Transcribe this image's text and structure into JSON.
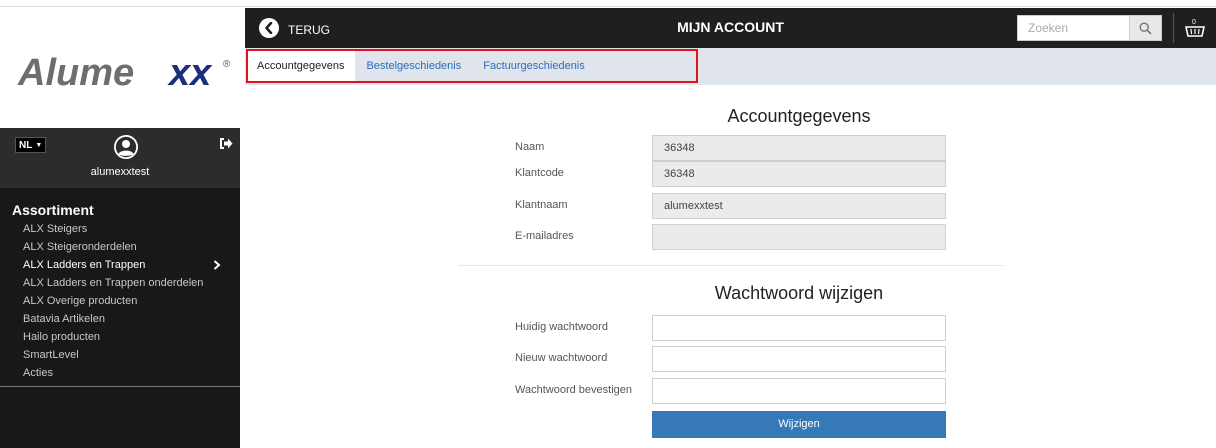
{
  "header": {
    "back_label": "TERUG",
    "title": "MIJN ACCOUNT",
    "search_placeholder": "Zoeken"
  },
  "logo": {
    "text": "Alumexx",
    "trademark": "®"
  },
  "tabs": [
    {
      "label": "Accountgegevens",
      "active": true
    },
    {
      "label": "Bestelgeschiedenis",
      "active": false
    },
    {
      "label": "Factuurgeschiedenis",
      "active": false
    }
  ],
  "sidebar": {
    "language": "NL",
    "username": "alumexxtest",
    "heading": "Assortiment",
    "items": [
      {
        "label": "ALX Steigers"
      },
      {
        "label": "ALX Steigeronderdelen"
      },
      {
        "label": "ALX Ladders en Trappen",
        "active": true
      },
      {
        "label": "ALX Ladders en Trappen onderdelen"
      },
      {
        "label": "ALX Overige producten"
      },
      {
        "label": "Batavia Artikelen"
      },
      {
        "label": "Hailo producten"
      },
      {
        "label": "SmartLevel"
      },
      {
        "label": "Acties"
      }
    ]
  },
  "account": {
    "title": "Accountgegevens",
    "fields": [
      {
        "label": "Naam",
        "value": "36348"
      },
      {
        "label": "Klantcode",
        "value": "36348"
      },
      {
        "label": "Klantnaam",
        "value": "alumexxtest"
      },
      {
        "label": "E-mailadres",
        "value": ""
      }
    ]
  },
  "password": {
    "title": "Wachtwoord wijzigen",
    "fields": [
      {
        "label": "Huidig wachtwoord",
        "value": ""
      },
      {
        "label": "Nieuw wachtwoord",
        "value": ""
      },
      {
        "label": "Wachtwoord bevestigen",
        "value": ""
      }
    ],
    "submit_label": "Wijzigen"
  },
  "colors": {
    "header_bg": "#1f1f1f",
    "tabbar_bg": "#dfe4ed",
    "link": "#2a6ebb",
    "highlight": "#e0141b",
    "button": "#357ab7",
    "sidebar_bg": "#181818"
  },
  "icons": {
    "back": "back-circle-icon",
    "search": "search-icon",
    "basket": "basket-icon",
    "avatar": "user-avatar-icon",
    "logout": "logout-icon",
    "chevron": "chevron-right-icon"
  }
}
